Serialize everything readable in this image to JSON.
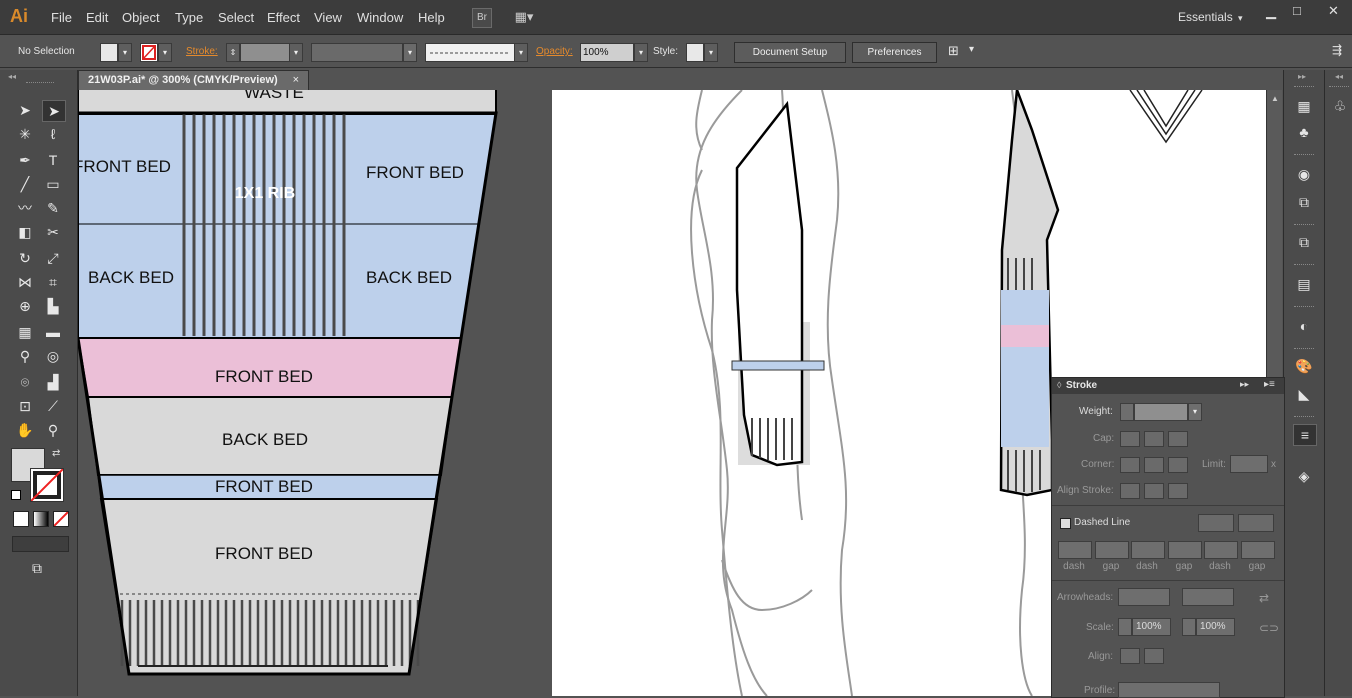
{
  "app": {
    "logo": "Ai"
  },
  "menu": [
    "File",
    "Edit",
    "Object",
    "Type",
    "Select",
    "Effect",
    "View",
    "Window",
    "Help"
  ],
  "menubar_buttons": {
    "bridge": "Br",
    "arrange": "▦▾"
  },
  "workspace": {
    "label": "Essentials",
    "arrow": "▾"
  },
  "window_controls": {
    "minimize": "▁",
    "maximize": "□",
    "close": "✕"
  },
  "control_bar": {
    "selection": "No Selection",
    "stroke_label": "Stroke:",
    "opacity_label": "Opacity:",
    "opacity_value": "100%",
    "style_label": "Style:",
    "document_setup": "Document Setup",
    "preferences": "Preferences"
  },
  "document": {
    "tab_title": "21W03P.ai* @ 300% (CMYK/Preview)",
    "close": "×"
  },
  "artwork": {
    "waste": "WASTE",
    "front_bed_1": "FRONT BED",
    "front_bed_2": "FRONT BED",
    "rib": "1X1 RIB",
    "back_bed_1": "BACK BED",
    "back_bed_2": "BACK BED",
    "front_bed_pink": "FRONT BED",
    "back_bed_grey": "BACK BED",
    "front_bed_blue": "FRONT BED",
    "front_bed_grey": "FRONT BED"
  },
  "stroke_panel": {
    "title": "Stroke",
    "weight_label": "Weight:",
    "cap_label": "Cap:",
    "corner_label": "Corner:",
    "limit_label": "Limit:",
    "limit_unit": "x",
    "align_label": "Align Stroke:",
    "dashed_label": "Dashed Line",
    "dash_labels": [
      "dash",
      "gap",
      "dash",
      "gap",
      "dash",
      "gap"
    ],
    "arrowheads_label": "Arrowheads:",
    "scale_label": "Scale:",
    "scale_1": "100%",
    "scale_2": "100%",
    "align2_label": "Align:",
    "profile_label": "Profile:"
  },
  "colors": {
    "blue": "#bdd0eb",
    "pink": "#ebbfd7",
    "grey": "#d9d9d9",
    "accent_orange": "#d98a2b"
  }
}
